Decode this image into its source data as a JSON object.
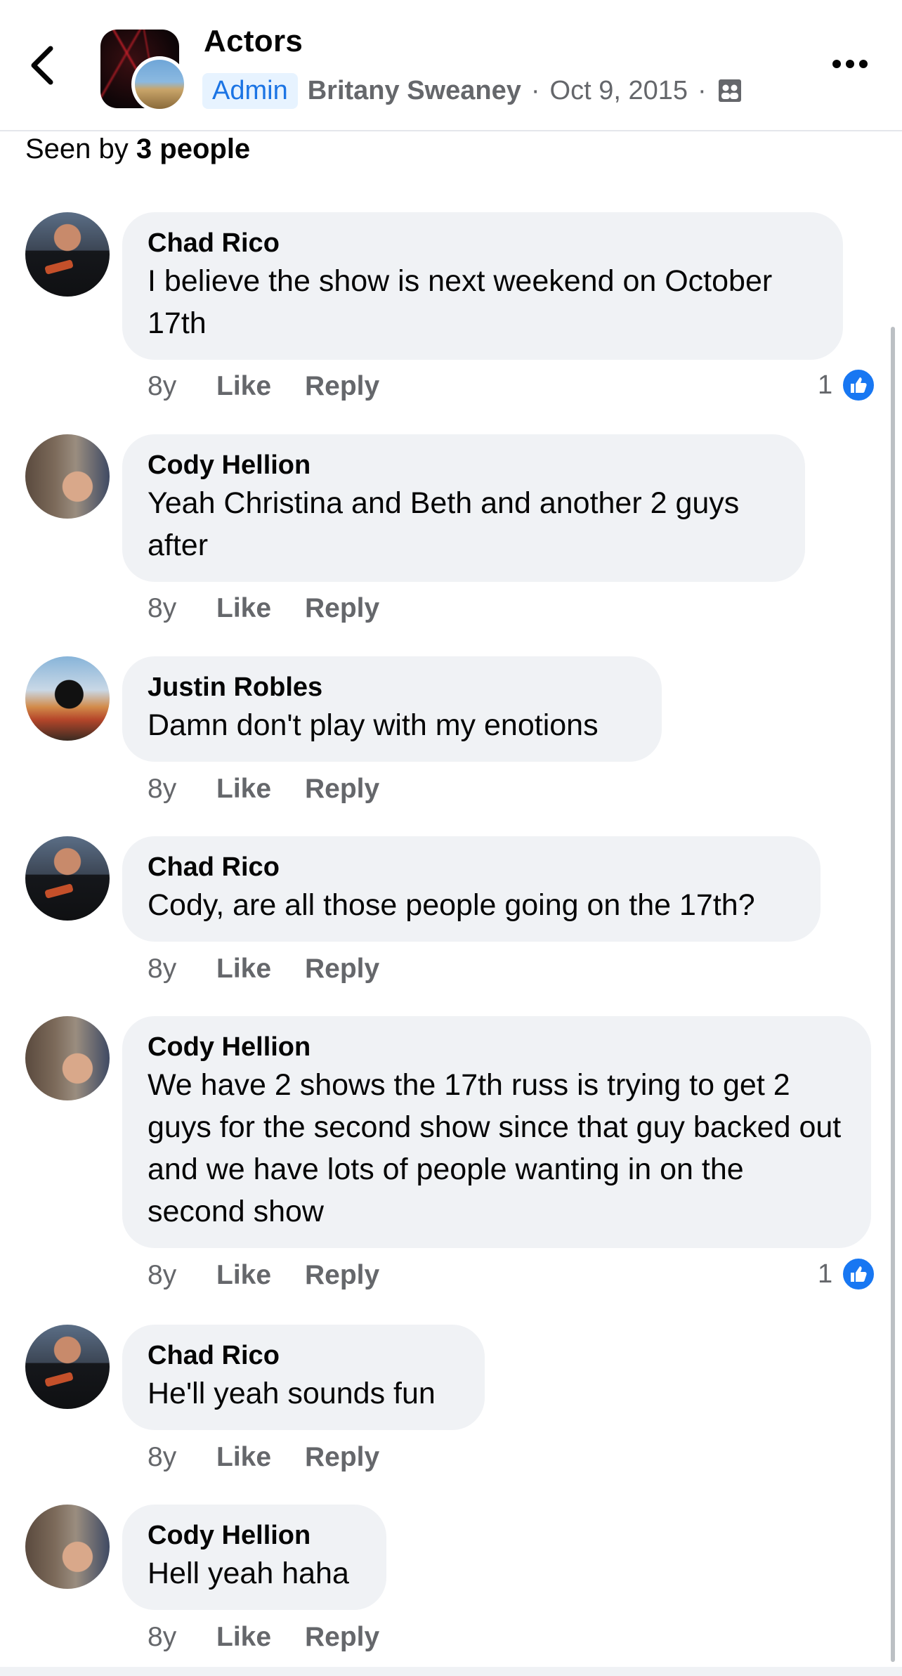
{
  "header": {
    "group_name": "Actors",
    "admin_badge": "Admin",
    "poster_name": "Britany Sweaney",
    "separator": "·",
    "date": "Oct 9, 2015"
  },
  "seen_by": {
    "prefix": "Seen by",
    "count": "3 people"
  },
  "actions": {
    "like": "Like",
    "reply": "Reply"
  },
  "comments": [
    {
      "author": "Chad Rico",
      "text": "I believe the show is next weekend on October 17th",
      "time": "8y",
      "reactions": "1"
    },
    {
      "author": "Cody Hellion",
      "text": "Yeah Christina and Beth and another 2 guys after",
      "time": "8y",
      "reactions": ""
    },
    {
      "author": "Justin Robles",
      "text": "Damn don't play with my enotions",
      "time": "8y",
      "reactions": ""
    },
    {
      "author": "Chad Rico",
      "text": "Cody, are all those people going on the 17th?",
      "time": "8y",
      "reactions": ""
    },
    {
      "author": "Cody Hellion",
      "text": "We have 2 shows the 17th russ is trying to get 2 guys for the second show since that guy backed out and we have lots of people wanting in on the second show",
      "time": "8y",
      "reactions": "1"
    },
    {
      "author": "Chad Rico",
      "text": "He'll yeah sounds fun",
      "time": "8y",
      "reactions": ""
    },
    {
      "author": "Cody Hellion",
      "text": "Hell yeah haha",
      "time": "8y",
      "reactions": ""
    }
  ],
  "colors": {
    "accent": "#1877f2",
    "bubble": "#f0f2f5",
    "secondary_text": "#65676b",
    "admin_badge_bg": "#e7f3ff"
  },
  "icons": [
    "back-arrow-icon",
    "group-privacy-icon",
    "more-options-icon",
    "like-thumb-icon"
  ]
}
